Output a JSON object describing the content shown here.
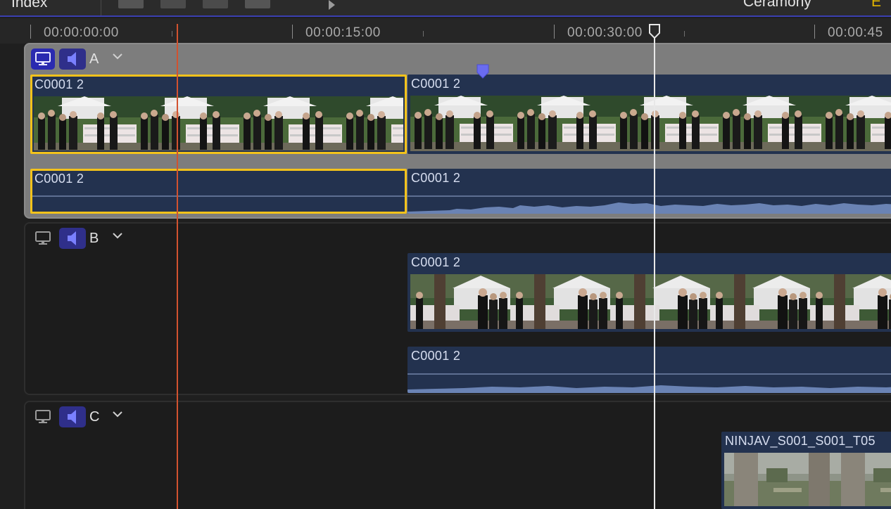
{
  "toolbar": {
    "title": "Index",
    "project_name": "Ceramony",
    "accent_text": "E"
  },
  "ruler": {
    "timecodes": [
      "00:00:00:00",
      "00:00:15:00",
      "00:00:30:00",
      "00:00:45"
    ]
  },
  "angles": [
    {
      "label": "A",
      "active": true,
      "video_active": true,
      "audio_active": true,
      "video_clips": [
        {
          "name": "C0001 2"
        },
        {
          "name": "C0001 2"
        }
      ],
      "audio_clips": [
        {
          "name": "C0001 2"
        },
        {
          "name": "C0001 2"
        }
      ]
    },
    {
      "label": "B",
      "active": false,
      "video_active": false,
      "audio_active": true,
      "video_clips": [
        {
          "name": "C0001 2"
        }
      ],
      "audio_clips": [
        {
          "name": "C0001 2"
        }
      ]
    },
    {
      "label": "C",
      "active": false,
      "video_active": false,
      "audio_active": true,
      "video_clips": [
        {
          "name": "NINJAV_S001_S001_T05"
        }
      ],
      "audio_clips": []
    }
  ],
  "colors": {
    "selection": "#f2c21b",
    "playhead": "#d2522f",
    "clip_bg": "#23324f",
    "angle_button_active": "#2a2ab0",
    "toolbar_accent": "#e0b400"
  },
  "icons": {
    "monitor": "monitor-icon",
    "speaker": "speaker-icon",
    "chevron": "chevron-down-icon",
    "marker": "marker-icon",
    "skimmer_handle": "skimmer-handle-icon"
  }
}
